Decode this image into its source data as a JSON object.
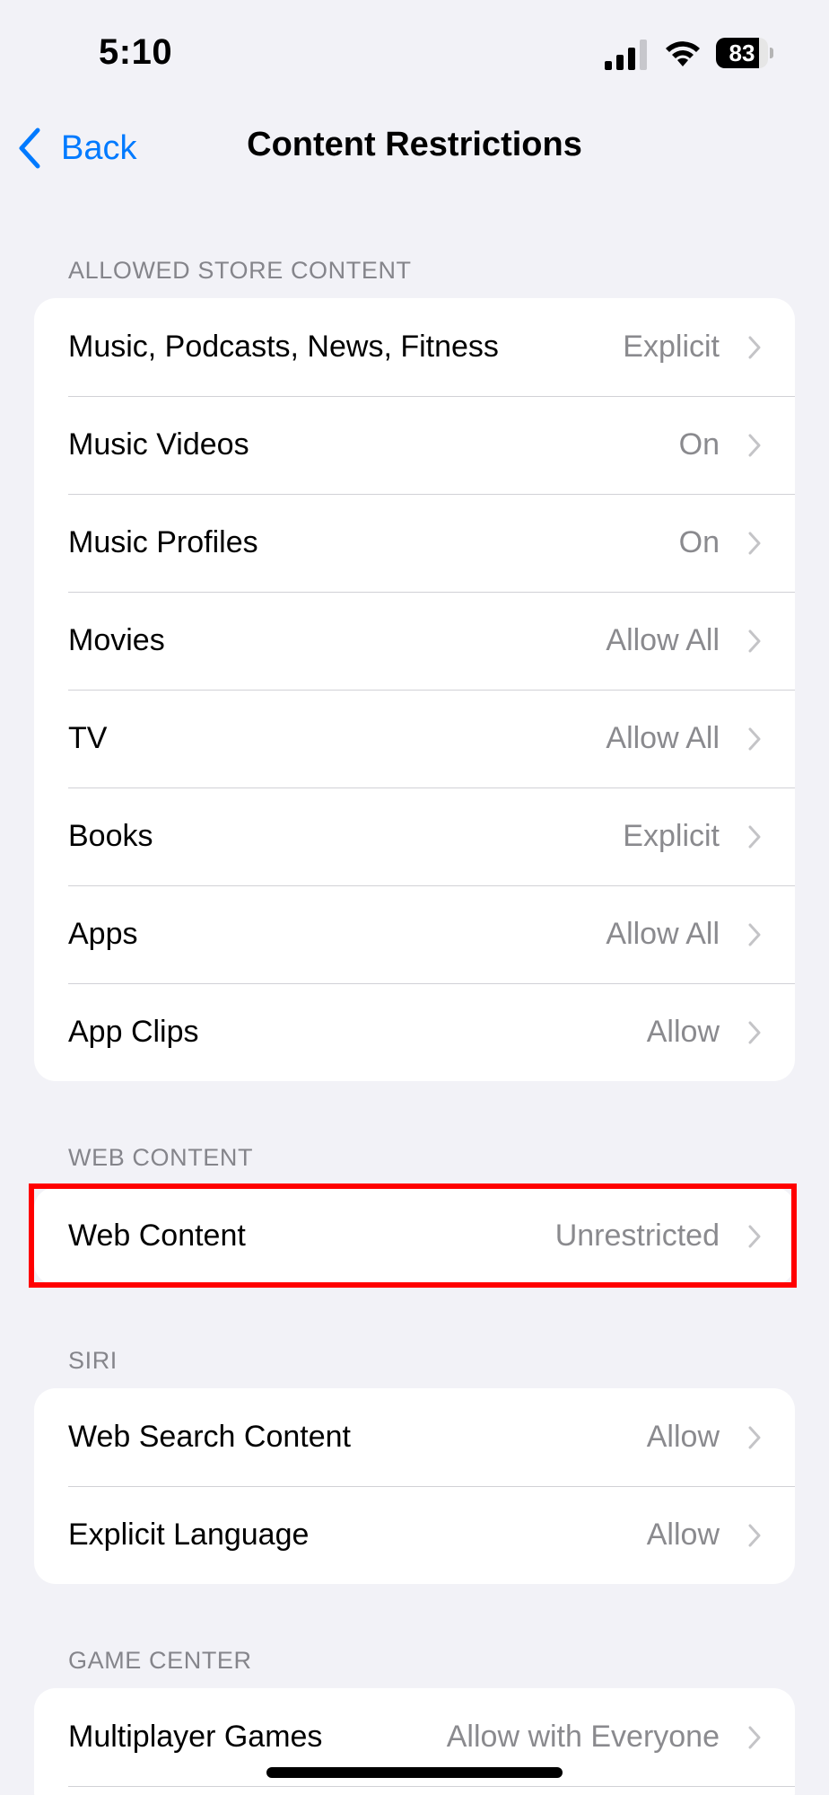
{
  "status_bar": {
    "time": "5:10",
    "battery_level": "83"
  },
  "nav": {
    "back_label": "Back",
    "title": "Content Restrictions"
  },
  "sections": {
    "store": {
      "header": "ALLOWED STORE CONTENT",
      "rows": [
        {
          "label": "Music, Podcasts, News, Fitness",
          "value": "Explicit"
        },
        {
          "label": "Music Videos",
          "value": "On"
        },
        {
          "label": "Music Profiles",
          "value": "On"
        },
        {
          "label": "Movies",
          "value": "Allow All"
        },
        {
          "label": "TV",
          "value": "Allow All"
        },
        {
          "label": "Books",
          "value": "Explicit"
        },
        {
          "label": "Apps",
          "value": "Allow All"
        },
        {
          "label": "App Clips",
          "value": "Allow"
        }
      ]
    },
    "web": {
      "header": "WEB CONTENT",
      "rows": [
        {
          "label": "Web Content",
          "value": "Unrestricted"
        }
      ]
    },
    "siri": {
      "header": "SIRI",
      "rows": [
        {
          "label": "Web Search Content",
          "value": "Allow"
        },
        {
          "label": "Explicit Language",
          "value": "Allow"
        }
      ]
    },
    "game_center": {
      "header": "GAME CENTER",
      "rows": [
        {
          "label": "Multiplayer Games",
          "value": "Allow with Everyone"
        }
      ]
    }
  },
  "colors": {
    "accent": "#007aff",
    "highlight": "#ff0000",
    "background": "#f2f2f7"
  }
}
